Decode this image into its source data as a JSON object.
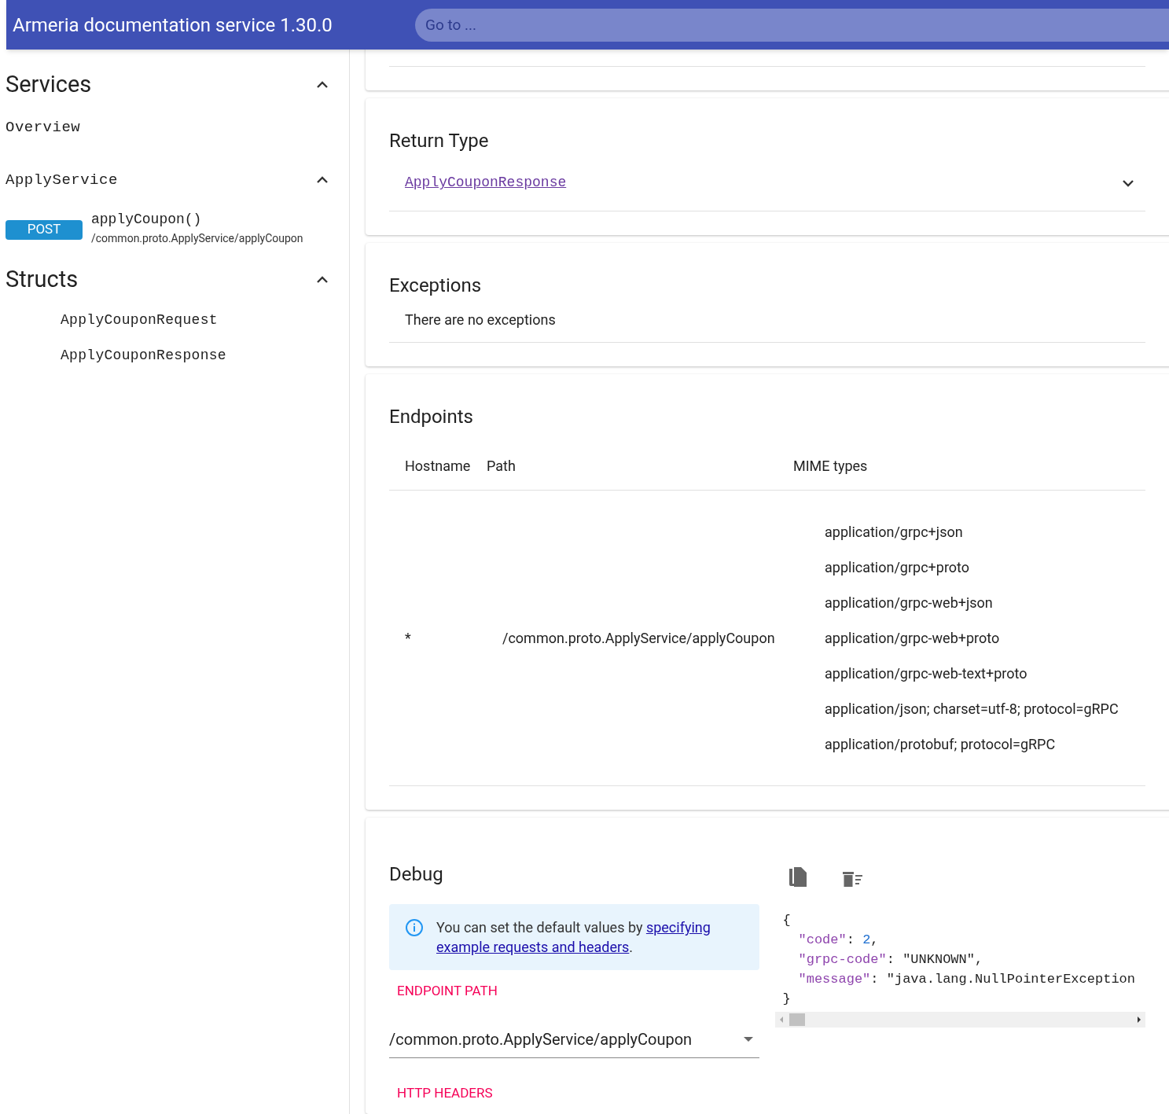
{
  "header": {
    "title": "Armeria documentation service 1.30.0",
    "search_placeholder": "Go to ..."
  },
  "sidebar": {
    "sections": [
      {
        "title": "Services",
        "expanded": true,
        "items": [
          {
            "kind": "link",
            "label": "Overview"
          },
          {
            "kind": "group",
            "label": "ApplyService",
            "expanded": true,
            "methods": [
              {
                "http_method": "POST",
                "name": "applyCoupon()",
                "path": "/common.proto.ApplyService/applyCoupon"
              }
            ]
          }
        ]
      },
      {
        "title": "Structs",
        "expanded": true,
        "items": [
          {
            "kind": "struct",
            "label": "ApplyCouponRequest"
          },
          {
            "kind": "struct",
            "label": "ApplyCouponResponse"
          }
        ]
      }
    ]
  },
  "return_type": {
    "title": "Return Type",
    "link": "ApplyCouponResponse",
    "expanded": false
  },
  "exceptions": {
    "title": "Exceptions",
    "message": "There are no exceptions"
  },
  "endpoints": {
    "title": "Endpoints",
    "columns": [
      "Hostname",
      "Path",
      "MIME types"
    ],
    "rows": [
      {
        "hostname": "*",
        "path": "/common.proto.ApplyService/applyCoupon",
        "mime_types": [
          "application/grpc+json",
          "application/grpc+proto",
          "application/grpc-web+json",
          "application/grpc-web+proto",
          "application/grpc-web-text+proto",
          "application/json; charset=utf-8; protocol=gRPC",
          "application/protobuf; protocol=gRPC"
        ]
      }
    ]
  },
  "debug": {
    "title": "Debug",
    "info_text": "You can set the default values by ",
    "info_link_lines": [
      "specifying",
      "example requests and headers"
    ],
    "info_end": ".",
    "endpoint_path_label": "ENDPOINT PATH",
    "endpoint_path_value": "/common.proto.ApplyService/applyCoupon",
    "http_headers_label": "HTTP HEADERS",
    "response": [
      {
        "key": "\"code\"",
        "sep": ": ",
        "value": "2",
        "end": ",",
        "kind": "number"
      },
      {
        "key": "\"grpc-code\"",
        "sep": ": ",
        "value": "\"UNKNOWN\"",
        "end": ",",
        "kind": "string"
      },
      {
        "key": "\"message\"",
        "sep": ": ",
        "value": "\"java.lang.NullPointerException",
        "kind": "string"
      }
    ],
    "open_brace": "{",
    "close_brace": "}"
  }
}
